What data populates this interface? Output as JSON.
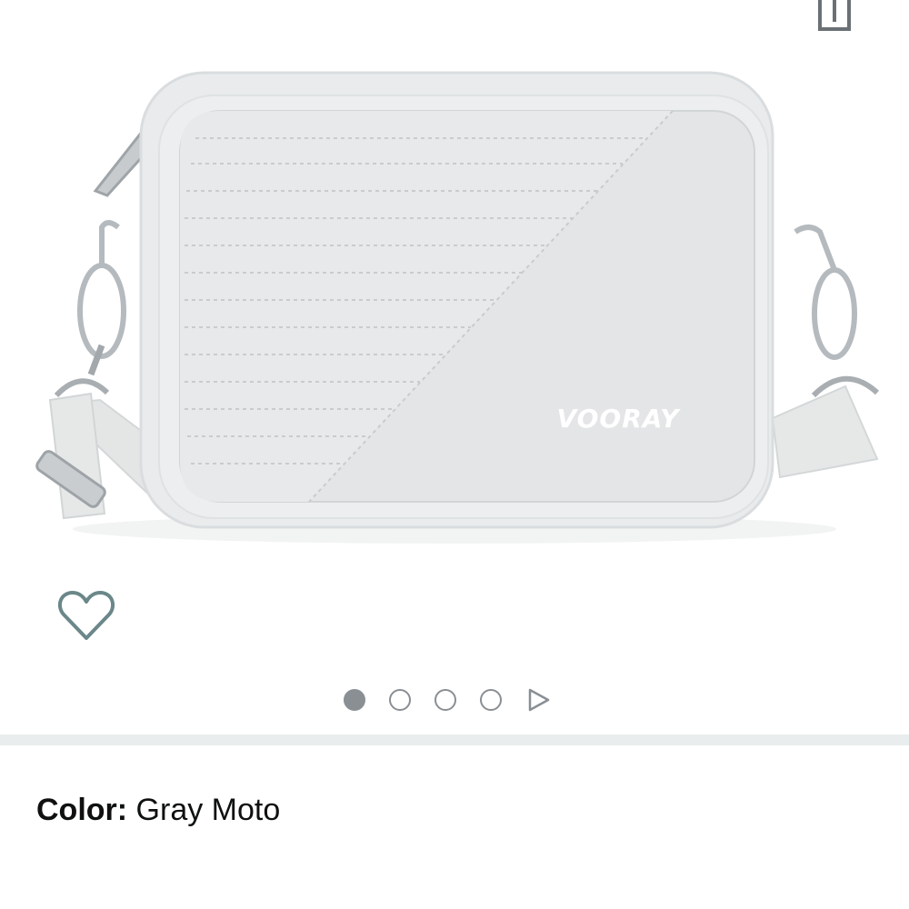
{
  "product": {
    "brand_text": "VOORAY",
    "image_alt": "Gray Moto crossbody bag"
  },
  "gallery": {
    "total_images": 4,
    "active_index": 0
  },
  "color": {
    "label": "Color:",
    "value": "Gray Moto"
  },
  "icons": {
    "share": "share-icon",
    "wishlist": "heart-outline-icon",
    "next": "play-triangle-icon"
  },
  "colors": {
    "icon_gray": "#8a8f94",
    "divider": "#eaeded",
    "text": "#0f1111"
  }
}
